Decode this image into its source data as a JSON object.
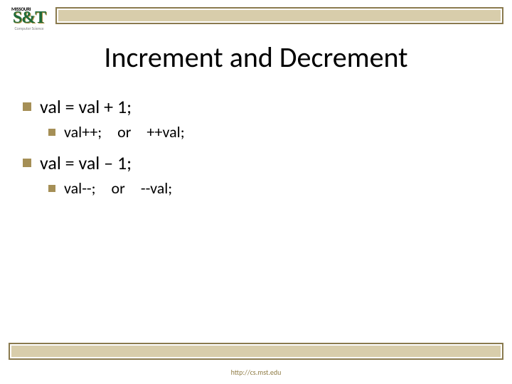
{
  "logo": {
    "top_text": "MISSOURI",
    "main_text": "S&T",
    "sub_text": "Computer Science"
  },
  "title": "Increment and Decrement",
  "bullets": {
    "item1": "val = val + 1;",
    "item1_sub": "val++; or ++val;",
    "item2": "val = val – 1;",
    "item2_sub": "val--; or --val;"
  },
  "footer_url": "http://cs.mst.edu"
}
